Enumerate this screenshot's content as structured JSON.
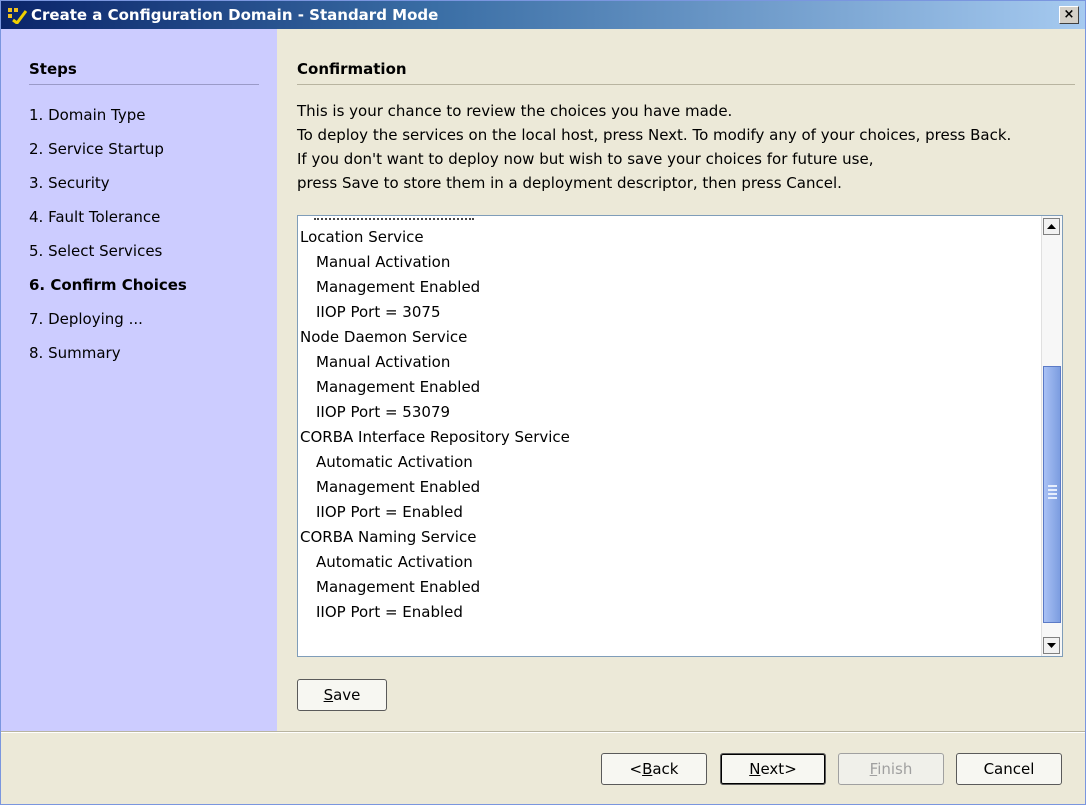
{
  "window": {
    "title": "Create a Configuration Domain - Standard Mode",
    "close_label": "×"
  },
  "steps": {
    "title": "Steps",
    "items": [
      {
        "label": "1. Domain Type",
        "current": false
      },
      {
        "label": "2. Service Startup",
        "current": false
      },
      {
        "label": "3. Security",
        "current": false
      },
      {
        "label": "4. Fault Tolerance",
        "current": false
      },
      {
        "label": "5. Select Services",
        "current": false
      },
      {
        "label": "6. Confirm Choices",
        "current": true
      },
      {
        "label": "7. Deploying ...",
        "current": false
      },
      {
        "label": "8. Summary",
        "current": false
      }
    ]
  },
  "confirmation": {
    "title": "Confirmation",
    "intro": [
      "This is your chance to review the choices you have made.",
      "To deploy the services on the local host, press Next. To modify any of your choices, press Back.",
      "If you don't want to deploy now but wish to save your choices for future use,",
      "press Save to store them in a deployment descriptor, then press Cancel."
    ],
    "summary_lines": [
      {
        "text": "Location Service",
        "indent": false
      },
      {
        "text": "Manual Activation",
        "indent": true
      },
      {
        "text": "Management Enabled",
        "indent": true
      },
      {
        "text": "IIOP Port = 3075",
        "indent": true
      },
      {
        "text": "Node Daemon Service",
        "indent": false
      },
      {
        "text": "Manual Activation",
        "indent": true
      },
      {
        "text": "Management Enabled",
        "indent": true
      },
      {
        "text": "IIOP Port = 53079",
        "indent": true
      },
      {
        "text": "CORBA Interface Repository Service",
        "indent": false
      },
      {
        "text": "Automatic Activation",
        "indent": true
      },
      {
        "text": "Management Enabled",
        "indent": true
      },
      {
        "text": "IIOP Port = Enabled",
        "indent": true
      },
      {
        "text": "CORBA Naming Service",
        "indent": false
      },
      {
        "text": "Automatic Activation",
        "indent": true
      },
      {
        "text": "Management Enabled",
        "indent": true
      },
      {
        "text": "IIOP Port = Enabled",
        "indent": true
      }
    ],
    "save_button": {
      "mnemonic": "S",
      "rest": "ave"
    }
  },
  "footer": {
    "back": {
      "prefix": "<",
      "mnemonic": "B",
      "rest": "ack"
    },
    "next": {
      "mnemonic": "N",
      "rest": "ext>"
    },
    "finish": {
      "mnemonic": "F",
      "rest": "inish"
    },
    "cancel": "Cancel"
  },
  "colors": {
    "steps_panel": "#ccccff",
    "title_bar_start": "#0a246a",
    "scroll_thumb": "#7c9de0"
  }
}
